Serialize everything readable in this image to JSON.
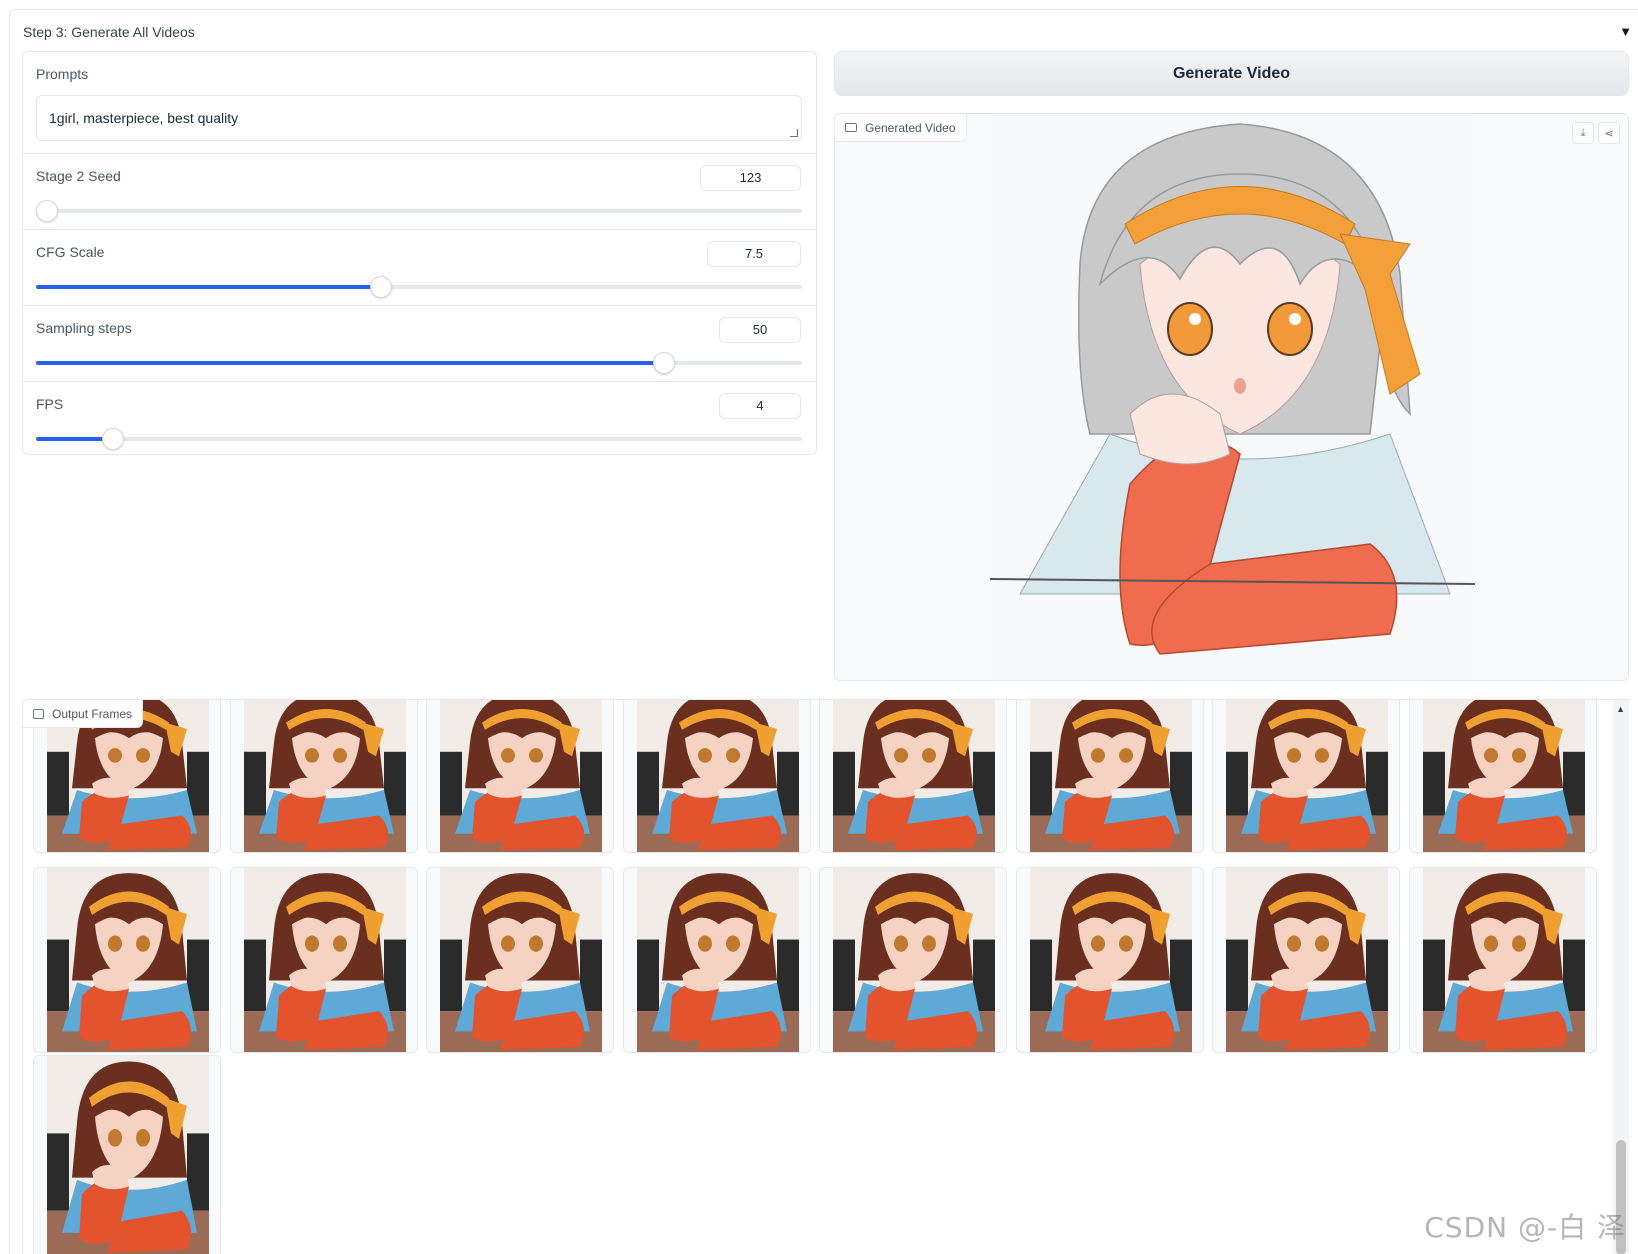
{
  "accordion": {
    "title": "Step 3: Generate All Videos",
    "caret": "▼"
  },
  "controls": {
    "prompts_label": "Prompts",
    "prompts_value": "1girl, masterpiece, best quality",
    "seed": {
      "label": "Stage 2 Seed",
      "value": "123",
      "fraction": 0.0
    },
    "cfg": {
      "label": "CFG Scale",
      "value": "7.5",
      "fraction": 0.45
    },
    "steps": {
      "label": "Sampling steps",
      "value": "50",
      "fraction": 0.82
    },
    "fps": {
      "label": "FPS",
      "value": "4",
      "fraction": 0.1
    }
  },
  "generate_button": "Generate Video",
  "video": {
    "label": "Generated Video",
    "download_icon": "download-icon",
    "share_icon": "share-icon"
  },
  "frames": {
    "label": "Output Frames",
    "count": 17,
    "palette": {
      "hair": "#6b2f1f",
      "headband": "#f0a030",
      "skin": "#f6d2c2",
      "shirt": "#5fa9d6",
      "sleeve": "#e2532e",
      "table": "#9b6b55",
      "bg": "#f2ece8"
    }
  },
  "video_palette": {
    "hair": "#c9c9c9",
    "headband": "#f3a03a",
    "skin": "#fbe6e0",
    "shirt": "#d8e8ee",
    "sleeve": "#ef6c4f",
    "eyes": "#f29a3a"
  },
  "watermark": "CSDN @-白 泽"
}
